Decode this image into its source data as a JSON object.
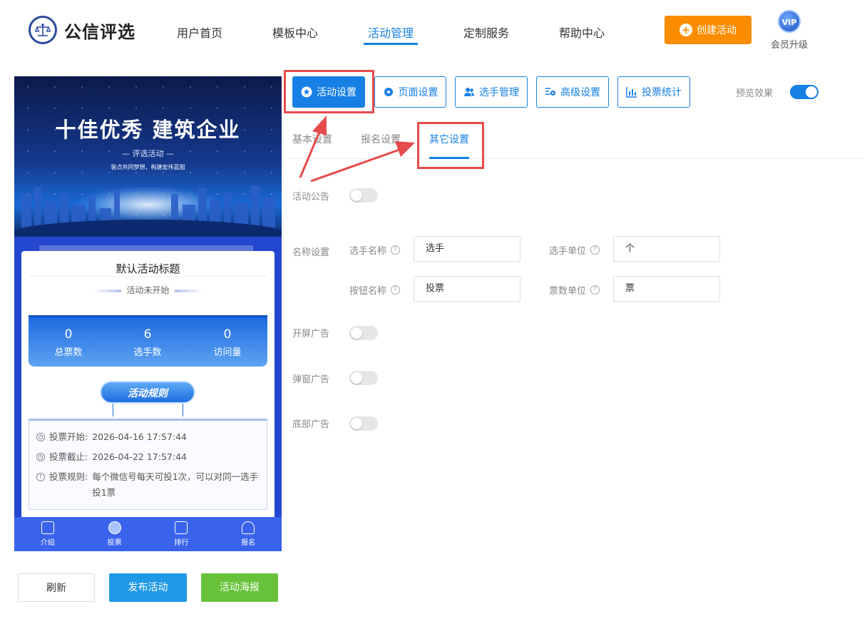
{
  "header": {
    "logo_text": "公信评选",
    "nav": [
      "用户首页",
      "模板中心",
      "活动管理",
      "定制服务",
      "帮助中心"
    ],
    "create_label": "创建活动",
    "vip_badge": "VIP",
    "vip_label": "会员升级"
  },
  "preview": {
    "banner_title": "十佳优秀 建筑企业",
    "banner_subtitle": "— 评选活动 —",
    "banner_slogan": "装点共同梦想，构建宏伟蓝图",
    "activity_title": "默认活动标题",
    "status": "活动未开始",
    "stats": [
      {
        "value": "0",
        "label": "总票数"
      },
      {
        "value": "6",
        "label": "选手数"
      },
      {
        "value": "0",
        "label": "访问量"
      }
    ],
    "rules_button": "活动规则",
    "rules": [
      {
        "label": "投票开始:",
        "value": "2026-04-16 17:57:44"
      },
      {
        "label": "投票截止:",
        "value": "2026-04-22 17:57:44"
      },
      {
        "label": "投票规则:",
        "value": "每个微信号每天可投1次，可以对同一选手投1票"
      }
    ],
    "tabs": [
      "介绍",
      "投票",
      "排行",
      "报名"
    ]
  },
  "bottom_buttons": {
    "refresh": "刷新",
    "publish": "发布活动",
    "poster": "活动海报"
  },
  "toolbar": {
    "buttons": [
      "活动设置",
      "页面设置",
      "选手管理",
      "高级设置",
      "投票统计"
    ],
    "preview_label": "预览效果"
  },
  "subtabs": [
    "基本设置",
    "报名设置",
    "其它设置"
  ],
  "form": {
    "notice_label": "活动公告",
    "name_label": "名称设置",
    "player_name_label": "选手名称",
    "player_name_value": "选手",
    "player_unit_label": "选手单位",
    "player_unit_value": "个",
    "button_name_label": "按钮名称",
    "button_name_value": "投票",
    "vote_unit_label": "票数单位",
    "vote_unit_value": "票",
    "splash_ad_label": "开屏广告",
    "popup_ad_label": "弹窗广告",
    "bottom_ad_label": "底部广告"
  },
  "colors": {
    "primary": "#1780e5",
    "orange": "#fb8c00",
    "green": "#67c23a",
    "annotation_red": "#e64b4b"
  }
}
